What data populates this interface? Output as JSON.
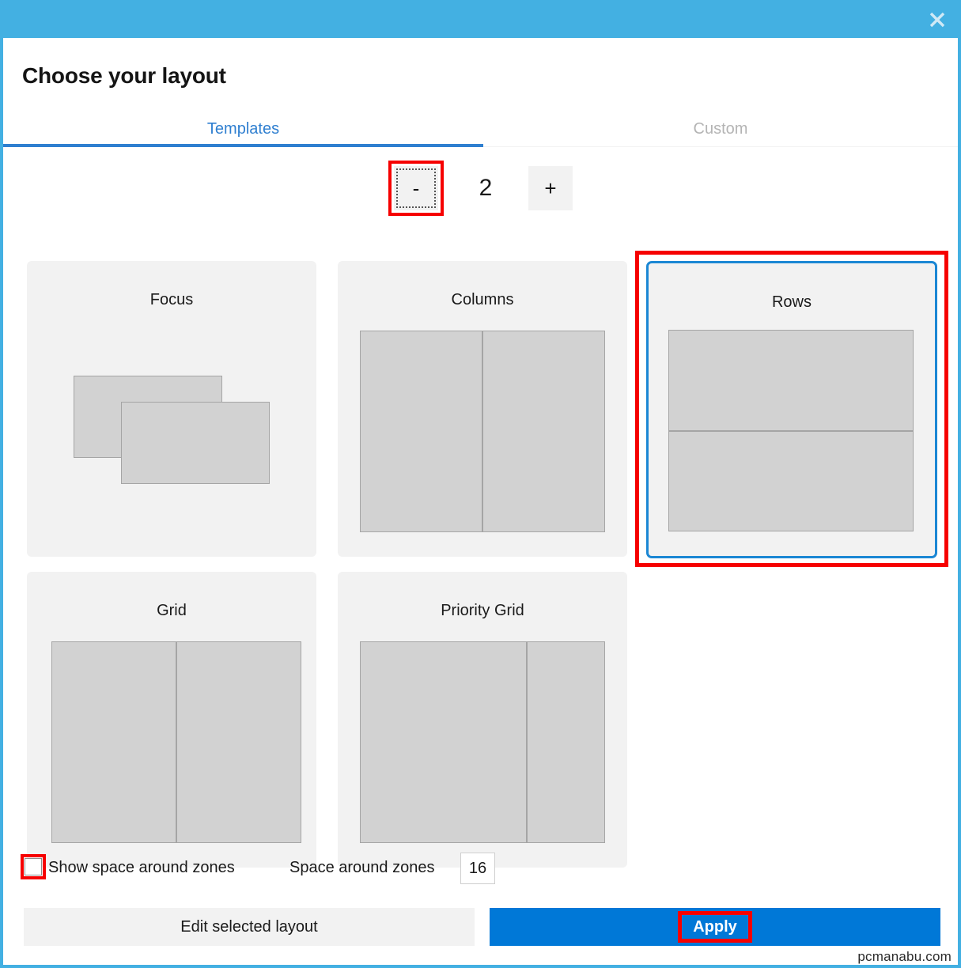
{
  "window": {
    "accent_color": "#43b0e2",
    "close_icon": "close-icon"
  },
  "header": {
    "title": "Choose your layout"
  },
  "tabs": [
    {
      "label": "Templates",
      "active": true
    },
    {
      "label": "Custom",
      "active": false
    }
  ],
  "stepper": {
    "decrement_label": "-",
    "value": "2",
    "increment_label": "+"
  },
  "templates": [
    {
      "name": "Focus",
      "selected": false,
      "zones": 2
    },
    {
      "name": "Columns",
      "selected": false,
      "zones": 2
    },
    {
      "name": "Rows",
      "selected": true,
      "zones": 2
    },
    {
      "name": "Grid",
      "selected": false,
      "zones": 2
    },
    {
      "name": "Priority Grid",
      "selected": false,
      "zones": 2
    }
  ],
  "options": {
    "show_space_label": "Show space around zones",
    "show_space_checked": false,
    "space_label": "Space around zones",
    "space_value": "16"
  },
  "footer": {
    "edit_label": "Edit selected layout",
    "apply_label": "Apply"
  },
  "watermark": "pcmanabu.com",
  "annotations": {
    "color": "#f60000",
    "targets": [
      "decrement-button",
      "rows-template-card",
      "show-space-checkbox",
      "apply-button"
    ]
  }
}
